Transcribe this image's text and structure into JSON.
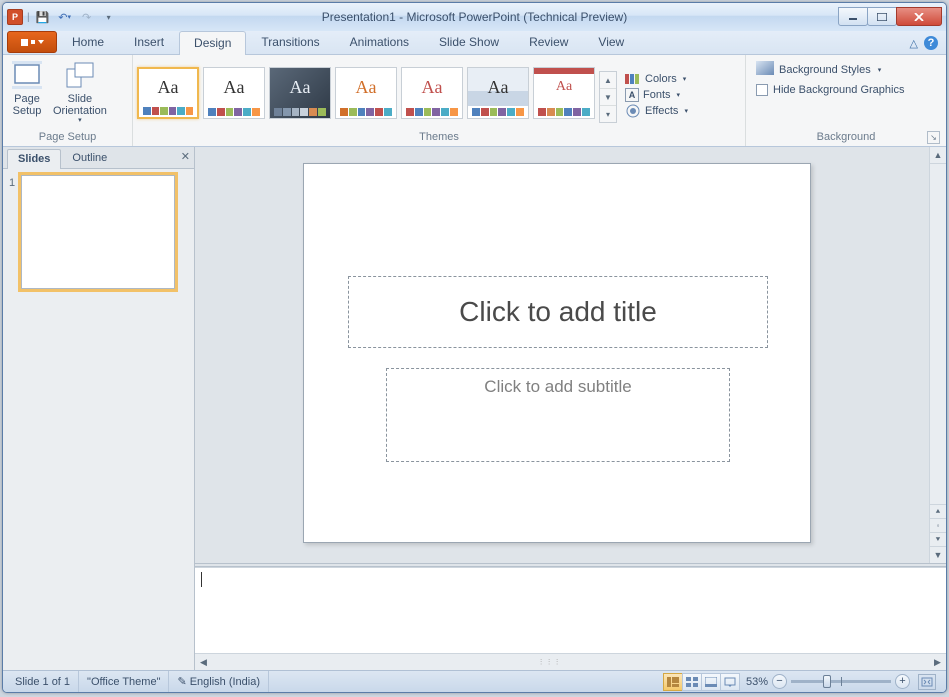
{
  "title": "Presentation1 - Microsoft PowerPoint (Technical Preview)",
  "qat": {
    "save": "💾",
    "undo": "↶",
    "redo": "↷"
  },
  "tabs": {
    "home": "Home",
    "insert": "Insert",
    "design": "Design",
    "transitions": "Transitions",
    "animations": "Animations",
    "slideshow": "Slide Show",
    "review": "Review",
    "view": "View"
  },
  "ribbon": {
    "page_setup_group": "Page Setup",
    "page_setup": "Page\nSetup",
    "slide_orientation": "Slide\nOrientation",
    "themes_group": "Themes",
    "colors": "Colors",
    "fonts": "Fonts",
    "effects": "Effects",
    "background_group": "Background",
    "bg_styles": "Background Styles",
    "hide_bg": "Hide Background Graphics"
  },
  "side": {
    "slides_tab": "Slides",
    "outline_tab": "Outline",
    "thumb_num": "1"
  },
  "slide": {
    "title_ph": "Click to add title",
    "subtitle_ph": "Click to add subtitle"
  },
  "status": {
    "slide": "Slide 1 of 1",
    "theme": "\"Office Theme\"",
    "lang": "English (India)",
    "zoom": "53%"
  }
}
